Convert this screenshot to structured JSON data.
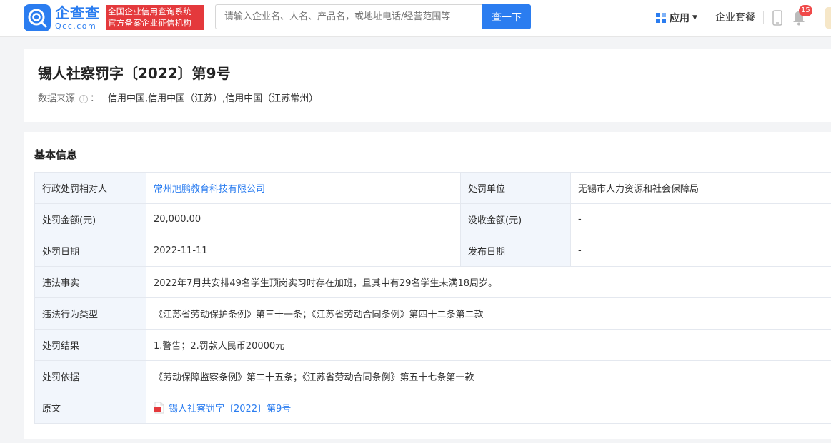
{
  "header": {
    "logo_text": "企查查",
    "logo_sub": "Qcc.com",
    "slogan_line1": "全国企业信用查询系统",
    "slogan_line2": "官方备案企业征信机构",
    "search_placeholder": "请输入企业名、人名、产品名，或地址电话/经营范围等",
    "search_button": "查一下",
    "apps_label": "应用",
    "suite_label": "企业套餐",
    "notification_count": "15"
  },
  "title_card": {
    "title": "锡人社察罚字〔2022〕第9号",
    "source_label": "数据来源",
    "source_colon": "：",
    "source_value": "信用中国,信用中国（江苏）,信用中国（江苏常州）"
  },
  "basic_info": {
    "section_title": "基本信息",
    "rows": [
      {
        "label1": "行政处罚相对人",
        "value1": "常州旭鹏教育科技有限公司",
        "label2": "处罚单位",
        "value2": "无锡市人力资源和社会保障局"
      },
      {
        "label1": "处罚金额(元)",
        "value1": "20,000.00",
        "label2": "没收金额(元)",
        "value2": "-"
      },
      {
        "label1": "处罚日期",
        "value1": "2022-11-11",
        "label2": "发布日期",
        "value2": "-"
      },
      {
        "label1": "违法事实",
        "value1": "2022年7月共安排49名学生顶岗实习时存在加班，且其中有29名学生未满18周岁。"
      },
      {
        "label1": "违法行为类型",
        "value1": "《江苏省劳动保护条例》第三十一条；《江苏省劳动合同条例》第四十二条第二款"
      },
      {
        "label1": "处罚结果",
        "value1": "1.警告；2.罚款人民币20000元"
      },
      {
        "label1": "处罚依据",
        "value1": "《劳动保障监察条例》第二十五条；《江苏省劳动合同条例》第五十七条第一款"
      },
      {
        "label1": "原文",
        "value1": "锡人社察罚字〔2022〕第9号"
      }
    ]
  },
  "colors": {
    "brand_blue": "#2b7df0",
    "slogan_red": "#e4393c",
    "label_bg": "#f2f6fc"
  }
}
